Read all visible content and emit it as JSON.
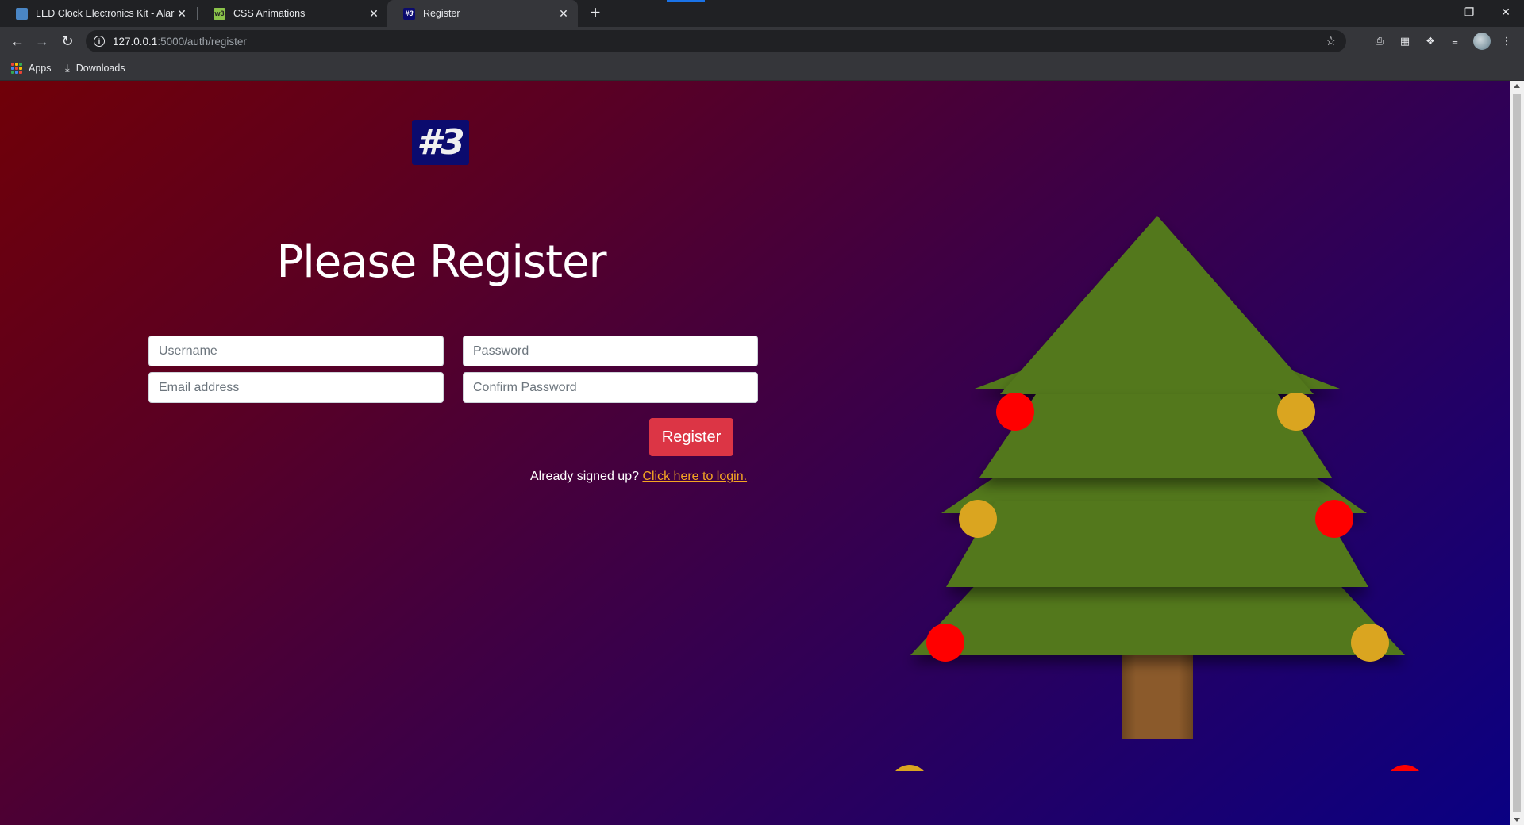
{
  "browser": {
    "tabs": [
      {
        "title": "LED Clock Electronics Kit - Alarm",
        "favicon": "kit-favicon-icon",
        "active": false
      },
      {
        "title": "CSS Animations",
        "favicon": "w3schools-favicon-icon",
        "active": false
      },
      {
        "title": "Register",
        "favicon": "#3",
        "active": true
      }
    ],
    "url_host": "127.0.0.1",
    "url_path": ":5000/auth/register",
    "bookmarks": [
      "Apps",
      "Downloads"
    ],
    "colors": {
      "chrome_dark": "#202124",
      "chrome_mid": "#35363a",
      "text": "#e8eaed"
    }
  },
  "page": {
    "logo_text": "#3",
    "heading": "Please Register",
    "form": {
      "username_placeholder": "Username",
      "password_placeholder": "Password",
      "email_placeholder": "Email address",
      "confirm_placeholder": "Confirm Password",
      "submit_label": "Register"
    },
    "signin_prompt": "Already signed up?",
    "signin_link": "Click here to login.",
    "colors": {
      "gradient_start": "#700008",
      "gradient_end": "#0a0082",
      "button": "#dc3545",
      "link": "#f5a623",
      "tree_green": "#53781c",
      "trunk": "#8b5a2b",
      "ornament_red": "#ff0000",
      "ornament_gold": "#daa520"
    },
    "tree": {
      "tiers": 4,
      "ornaments": [
        "red",
        "gold",
        "gold",
        "red",
        "red",
        "gold",
        "gold",
        "red"
      ]
    }
  }
}
